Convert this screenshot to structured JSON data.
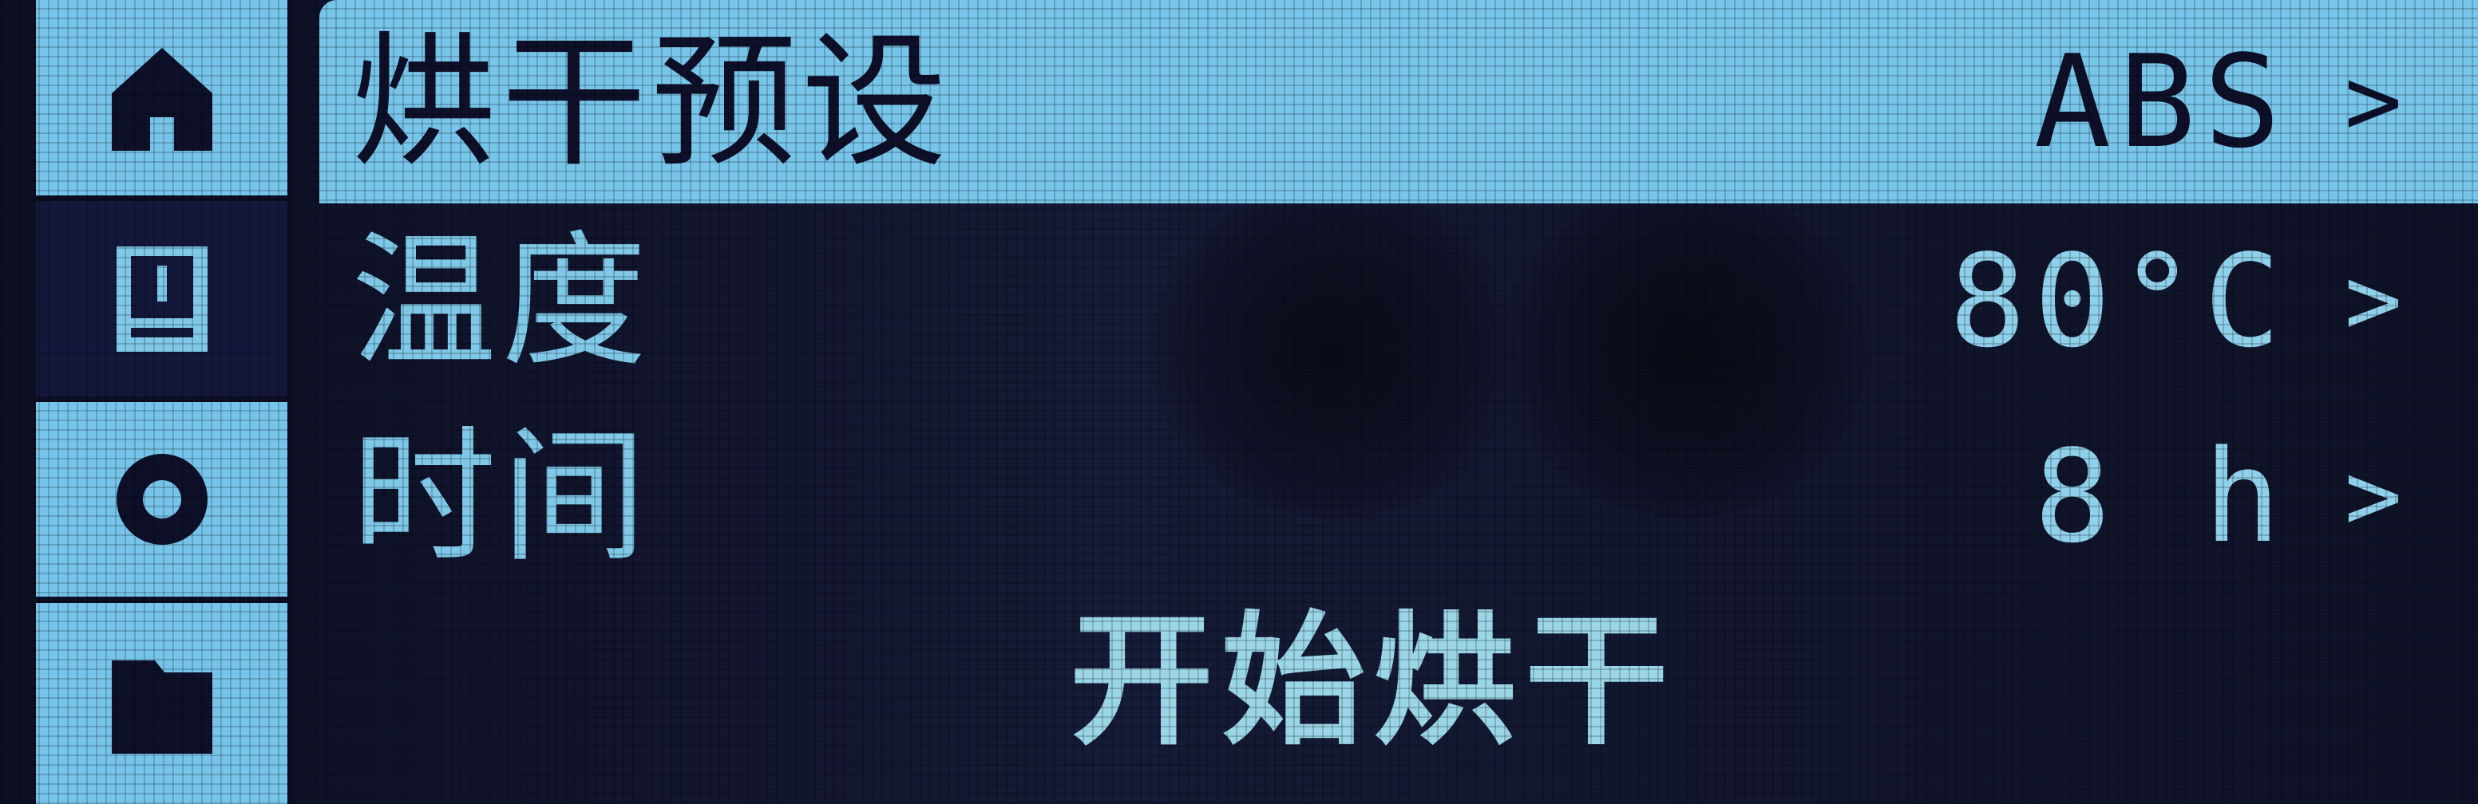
{
  "sidebar": {
    "items": [
      {
        "icon": "home-icon",
        "active": true
      },
      {
        "icon": "printer-icon",
        "active": false
      },
      {
        "icon": "settings-icon",
        "active": true
      },
      {
        "icon": "folder-icon",
        "active": true
      }
    ]
  },
  "menu": {
    "preset": {
      "label": "烘干预设",
      "value": "ABS",
      "chevron": ">"
    },
    "temperature": {
      "label": "温度",
      "value": "80°C",
      "chevron": ">"
    },
    "time": {
      "label": "时间",
      "value": "8 h",
      "chevron": ">"
    }
  },
  "action": {
    "start_label": "开始烘干"
  },
  "colors": {
    "accent": "#78c5ea",
    "background": "#0c0f22",
    "text_dark": "#0d1028"
  }
}
